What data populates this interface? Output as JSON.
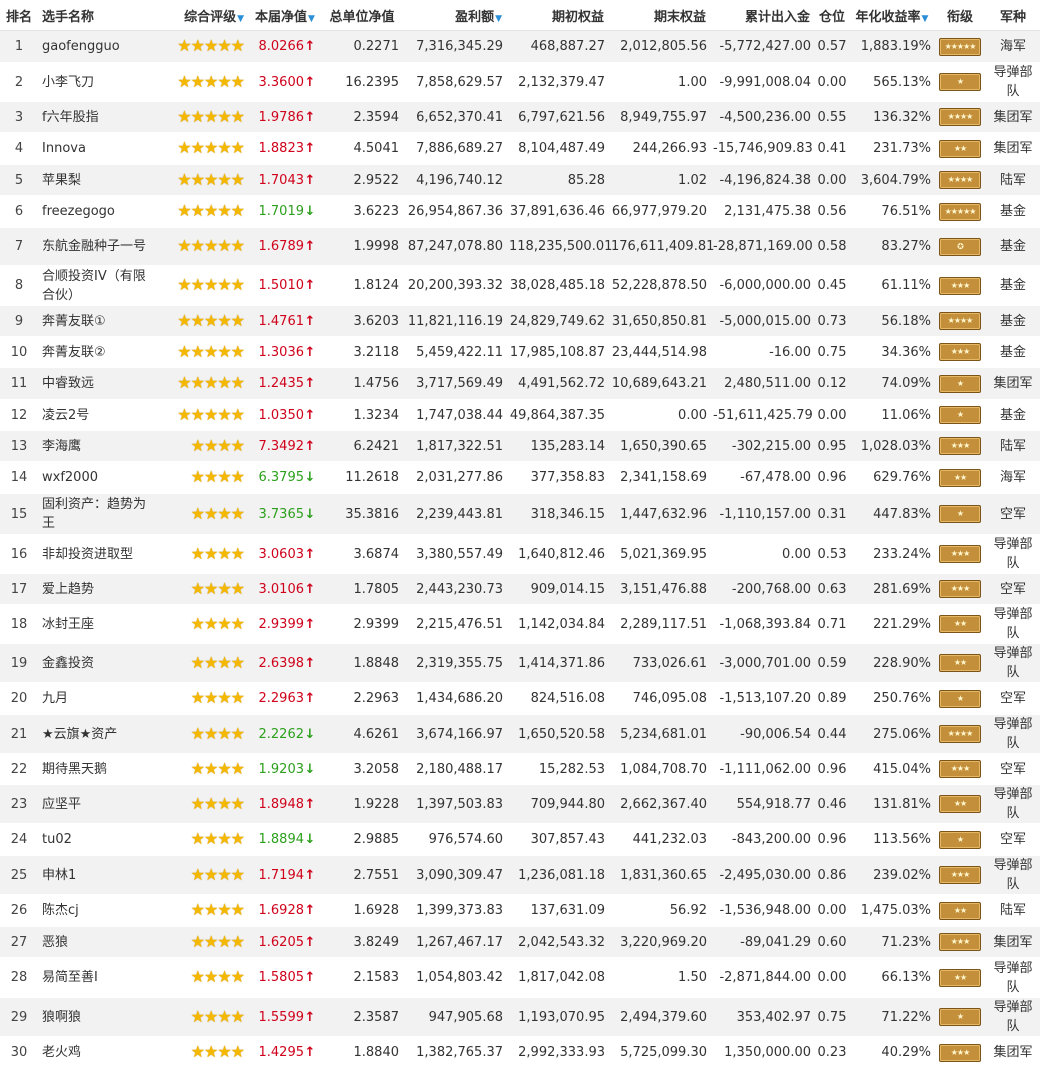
{
  "headers": {
    "rank": "排名",
    "name": "选手名称",
    "rating": "综合评级",
    "net": "本届净值",
    "unit_net": "总单位净值",
    "profit": "盈利额",
    "init_equity": "期初权益",
    "end_equity": "期末权益",
    "cash_flow": "累计出入金",
    "position": "仓位",
    "annual": "年化收益率",
    "grade": "衔级",
    "branch": "军种"
  },
  "sort_icon": "triangle-down-icon",
  "colors": {
    "up": "#d0021b",
    "down": "#2ca01c",
    "star": "#f5b800",
    "badge": "#c48f3a",
    "row_alt": "#f2f2f2"
  },
  "rows": [
    {
      "rank": "1",
      "name": "gaofengguo",
      "stars": 5,
      "net": "8.0266",
      "dir": "up",
      "unit": "0.2271",
      "profit": "7,316,345.29",
      "init": "468,887.27",
      "end": "2,012,805.56",
      "cash": "-5,772,427.00",
      "pos": "0.57",
      "annual": "1,883.19%",
      "badge": "★★★★★",
      "branch": "海军"
    },
    {
      "rank": "2",
      "name": "小李飞刀",
      "stars": 5,
      "net": "3.3600",
      "dir": "up",
      "unit": "16.2395",
      "profit": "7,858,629.57",
      "init": "2,132,379.47",
      "end": "1.00",
      "cash": "-9,991,008.04",
      "pos": "0.00",
      "annual": "565.13%",
      "badge": "★",
      "branch": "导弹部队"
    },
    {
      "rank": "3",
      "name": "f六年股指",
      "stars": 5,
      "net": "1.9786",
      "dir": "up",
      "unit": "2.3594",
      "profit": "6,652,370.41",
      "init": "6,797,621.56",
      "end": "8,949,755.97",
      "cash": "-4,500,236.00",
      "pos": "0.55",
      "annual": "136.32%",
      "badge": "★★★★",
      "branch": "集团军"
    },
    {
      "rank": "4",
      "name": "Innova",
      "stars": 5,
      "net": "1.8823",
      "dir": "up",
      "unit": "4.5041",
      "profit": "7,886,689.27",
      "init": "8,104,487.49",
      "end": "244,266.93",
      "cash": "-15,746,909.83",
      "pos": "0.41",
      "annual": "231.73%",
      "badge": "★★",
      "branch": "集团军"
    },
    {
      "rank": "5",
      "name": "苹果梨",
      "stars": 5,
      "net": "1.7043",
      "dir": "up",
      "unit": "2.9522",
      "profit": "4,196,740.12",
      "init": "85.28",
      "end": "1.02",
      "cash": "-4,196,824.38",
      "pos": "0.00",
      "annual": "3,604.79%",
      "badge": "★★★★",
      "branch": "陆军"
    },
    {
      "rank": "6",
      "name": "freezegogo",
      "stars": 5,
      "net": "1.7019",
      "dir": "down",
      "unit": "3.6223",
      "profit": "26,954,867.36",
      "init": "37,891,636.46",
      "end": "66,977,979.20",
      "cash": "2,131,475.38",
      "pos": "0.56",
      "annual": "76.51%",
      "badge": "★★★★★",
      "branch": "基金"
    },
    {
      "rank": "7",
      "name": "东航金融种子一号",
      "stars": 5,
      "net": "1.6789",
      "dir": "up",
      "unit": "1.9998",
      "profit": "87,247,078.80",
      "init": "118,235,500.01",
      "end": "176,611,409.81",
      "cash": "-28,871,169.00",
      "pos": "0.58",
      "annual": "83.27%",
      "badge": "✪",
      "branch": "基金"
    },
    {
      "rank": "8",
      "name": "合顺投资IV（有限合伙）",
      "stars": 5,
      "net": "1.5010",
      "dir": "up",
      "unit": "1.8124",
      "profit": "20,200,393.32",
      "init": "38,028,485.18",
      "end": "52,228,878.50",
      "cash": "-6,000,000.00",
      "pos": "0.45",
      "annual": "61.11%",
      "badge": "★★★",
      "branch": "基金"
    },
    {
      "rank": "9",
      "name": "奔菁友联①",
      "stars": 5,
      "net": "1.4761",
      "dir": "up",
      "unit": "3.6203",
      "profit": "11,821,116.19",
      "init": "24,829,749.62",
      "end": "31,650,850.81",
      "cash": "-5,000,015.00",
      "pos": "0.73",
      "annual": "56.18%",
      "badge": "★★★★",
      "branch": "基金"
    },
    {
      "rank": "10",
      "name": "奔菁友联②",
      "stars": 5,
      "net": "1.3036",
      "dir": "up",
      "unit": "3.2118",
      "profit": "5,459,422.11",
      "init": "17,985,108.87",
      "end": "23,444,514.98",
      "cash": "-16.00",
      "pos": "0.75",
      "annual": "34.36%",
      "badge": "★★★",
      "branch": "基金"
    },
    {
      "rank": "11",
      "name": "中睿致远",
      "stars": 5,
      "net": "1.2435",
      "dir": "up",
      "unit": "1.4756",
      "profit": "3,717,569.49",
      "init": "4,491,562.72",
      "end": "10,689,643.21",
      "cash": "2,480,511.00",
      "pos": "0.12",
      "annual": "74.09%",
      "badge": "★",
      "branch": "集团军"
    },
    {
      "rank": "12",
      "name": "凌云2号",
      "stars": 5,
      "net": "1.0350",
      "dir": "up",
      "unit": "1.3234",
      "profit": "1,747,038.44",
      "init": "49,864,387.35",
      "end": "0.00",
      "cash": "-51,611,425.79",
      "pos": "0.00",
      "annual": "11.06%",
      "badge": "★",
      "branch": "基金"
    },
    {
      "rank": "13",
      "name": "李海鹰",
      "stars": 4,
      "net": "7.3492",
      "dir": "up",
      "unit": "6.2421",
      "profit": "1,817,322.51",
      "init": "135,283.14",
      "end": "1,650,390.65",
      "cash": "-302,215.00",
      "pos": "0.95",
      "annual": "1,028.03%",
      "badge": "★★★",
      "branch": "陆军"
    },
    {
      "rank": "14",
      "name": "wxf2000",
      "stars": 4,
      "net": "6.3795",
      "dir": "down",
      "unit": "11.2618",
      "profit": "2,031,277.86",
      "init": "377,358.83",
      "end": "2,341,158.69",
      "cash": "-67,478.00",
      "pos": "0.96",
      "annual": "629.76%",
      "badge": "★★",
      "branch": "海军"
    },
    {
      "rank": "15",
      "name": "固利资产：趋势为王",
      "stars": 4,
      "net": "3.7365",
      "dir": "down",
      "unit": "35.3816",
      "profit": "2,239,443.81",
      "init": "318,346.15",
      "end": "1,447,632.96",
      "cash": "-1,110,157.00",
      "pos": "0.31",
      "annual": "447.83%",
      "badge": "★",
      "branch": "空军"
    },
    {
      "rank": "16",
      "name": "非却投资进取型",
      "stars": 4,
      "net": "3.0603",
      "dir": "up",
      "unit": "3.6874",
      "profit": "3,380,557.49",
      "init": "1,640,812.46",
      "end": "5,021,369.95",
      "cash": "0.00",
      "pos": "0.53",
      "annual": "233.24%",
      "badge": "★★★",
      "branch": "导弹部队"
    },
    {
      "rank": "17",
      "name": "爱上趋势",
      "stars": 4,
      "net": "3.0106",
      "dir": "up",
      "unit": "1.7805",
      "profit": "2,443,230.73",
      "init": "909,014.15",
      "end": "3,151,476.88",
      "cash": "-200,768.00",
      "pos": "0.63",
      "annual": "281.69%",
      "badge": "★★★",
      "branch": "空军"
    },
    {
      "rank": "18",
      "name": "冰封王座",
      "stars": 4,
      "net": "2.9399",
      "dir": "up",
      "unit": "2.9399",
      "profit": "2,215,476.51",
      "init": "1,142,034.84",
      "end": "2,289,117.51",
      "cash": "-1,068,393.84",
      "pos": "0.71",
      "annual": "221.29%",
      "badge": "★★",
      "branch": "导弹部队"
    },
    {
      "rank": "19",
      "name": "金鑫投资",
      "stars": 4,
      "net": "2.6398",
      "dir": "up",
      "unit": "1.8848",
      "profit": "2,319,355.75",
      "init": "1,414,371.86",
      "end": "733,026.61",
      "cash": "-3,000,701.00",
      "pos": "0.59",
      "annual": "228.90%",
      "badge": "★★",
      "branch": "导弹部队"
    },
    {
      "rank": "20",
      "name": "九月",
      "stars": 4,
      "net": "2.2963",
      "dir": "up",
      "unit": "2.2963",
      "profit": "1,434,686.20",
      "init": "824,516.08",
      "end": "746,095.08",
      "cash": "-1,513,107.20",
      "pos": "0.89",
      "annual": "250.76%",
      "badge": "★",
      "branch": "空军"
    },
    {
      "rank": "21",
      "name": "★云旗★资产",
      "stars": 4,
      "net": "2.2262",
      "dir": "down",
      "unit": "4.6261",
      "profit": "3,674,166.97",
      "init": "1,650,520.58",
      "end": "5,234,681.01",
      "cash": "-90,006.54",
      "pos": "0.44",
      "annual": "275.06%",
      "badge": "★★★★",
      "branch": "导弹部队"
    },
    {
      "rank": "22",
      "name": "期待黑天鹅",
      "stars": 4,
      "net": "1.9203",
      "dir": "down",
      "unit": "3.2058",
      "profit": "2,180,488.17",
      "init": "15,282.53",
      "end": "1,084,708.70",
      "cash": "-1,111,062.00",
      "pos": "0.96",
      "annual": "415.04%",
      "badge": "★★★",
      "branch": "空军"
    },
    {
      "rank": "23",
      "name": "应坚平",
      "stars": 4,
      "net": "1.8948",
      "dir": "up",
      "unit": "1.9228",
      "profit": "1,397,503.83",
      "init": "709,944.80",
      "end": "2,662,367.40",
      "cash": "554,918.77",
      "pos": "0.46",
      "annual": "131.81%",
      "badge": "★★",
      "branch": "导弹部队"
    },
    {
      "rank": "24",
      "name": "tu02",
      "stars": 4,
      "net": "1.8894",
      "dir": "down",
      "unit": "2.9885",
      "profit": "976,574.60",
      "init": "307,857.43",
      "end": "441,232.03",
      "cash": "-843,200.00",
      "pos": "0.96",
      "annual": "113.56%",
      "badge": "★",
      "branch": "空军"
    },
    {
      "rank": "25",
      "name": "申林1",
      "stars": 4,
      "net": "1.7194",
      "dir": "up",
      "unit": "2.7551",
      "profit": "3,090,309.47",
      "init": "1,236,081.18",
      "end": "1,831,360.65",
      "cash": "-2,495,030.00",
      "pos": "0.86",
      "annual": "239.02%",
      "badge": "★★★",
      "branch": "导弹部队"
    },
    {
      "rank": "26",
      "name": "陈杰cj",
      "stars": 4,
      "net": "1.6928",
      "dir": "up",
      "unit": "1.6928",
      "profit": "1,399,373.83",
      "init": "137,631.09",
      "end": "56.92",
      "cash": "-1,536,948.00",
      "pos": "0.00",
      "annual": "1,475.03%",
      "badge": "★★",
      "branch": "陆军"
    },
    {
      "rank": "27",
      "name": "恶狼",
      "stars": 4,
      "net": "1.6205",
      "dir": "up",
      "unit": "3.8249",
      "profit": "1,267,467.17",
      "init": "2,042,543.32",
      "end": "3,220,969.20",
      "cash": "-89,041.29",
      "pos": "0.60",
      "annual": "71.23%",
      "badge": "★★★",
      "branch": "集团军"
    },
    {
      "rank": "28",
      "name": "易简至善I",
      "stars": 4,
      "net": "1.5805",
      "dir": "up",
      "unit": "2.1583",
      "profit": "1,054,803.42",
      "init": "1,817,042.08",
      "end": "1.50",
      "cash": "-2,871,844.00",
      "pos": "0.00",
      "annual": "66.13%",
      "badge": "★★",
      "branch": "导弹部队"
    },
    {
      "rank": "29",
      "name": "狼啊狼",
      "stars": 4,
      "net": "1.5599",
      "dir": "up",
      "unit": "2.3587",
      "profit": "947,905.68",
      "init": "1,193,070.95",
      "end": "2,494,379.60",
      "cash": "353,402.97",
      "pos": "0.75",
      "annual": "71.22%",
      "badge": "★",
      "branch": "导弹部队"
    },
    {
      "rank": "30",
      "name": "老火鸡",
      "stars": 4,
      "net": "1.4295",
      "dir": "up",
      "unit": "1.8840",
      "profit": "1,382,765.37",
      "init": "2,992,333.93",
      "end": "5,725,099.30",
      "cash": "1,350,000.00",
      "pos": "0.23",
      "annual": "40.29%",
      "badge": "★★★",
      "branch": "集团军"
    }
  ]
}
